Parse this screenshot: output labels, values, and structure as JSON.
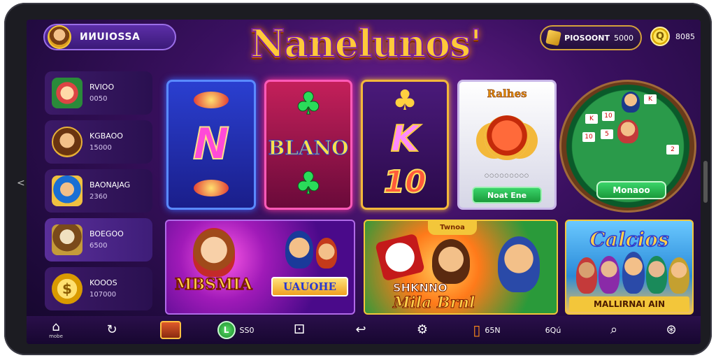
{
  "header": {
    "profile_name": "ИИUIОSSА",
    "logo": "Nanelunos'",
    "currency_label": "PIOSOONT",
    "currency_value": "5000",
    "coins_value": "8085"
  },
  "sidebar": {
    "items": [
      {
        "title": "RVIOO",
        "sub": "0050"
      },
      {
        "title": "KGBAOO",
        "sub": "15000"
      },
      {
        "title": "BAONAJAG",
        "sub": "2360"
      },
      {
        "title": "BOEGOO",
        "sub": "6500"
      },
      {
        "title": "KOOOS",
        "sub": "107000"
      }
    ]
  },
  "cards": {
    "card1": {
      "letter": "N"
    },
    "card2": {
      "text": "BLANO"
    },
    "card3": {
      "letter": "K",
      "number": "10"
    },
    "card4": {
      "title": "Ralhes",
      "sub": "○○○○○○○○○",
      "button": "Noat Ene"
    },
    "card5": {
      "button": "Monaoo",
      "cards": [
        "K",
        "10",
        "10",
        "5",
        "K",
        "2"
      ]
    }
  },
  "banners": {
    "banner1": {
      "main": "MBSMIA",
      "tag": "UAUOHE"
    },
    "banner2": {
      "top": "Twnoa",
      "main": "SHKNNO",
      "script": "Mila Brnl"
    },
    "banner3": {
      "main": "Calcios",
      "bottom": "MALLIRNAI AIN"
    }
  },
  "bottom_nav": {
    "home_label": "mobe",
    "item3_value": "SS0",
    "item6_value": "65N",
    "item7_value": "6Qú"
  }
}
